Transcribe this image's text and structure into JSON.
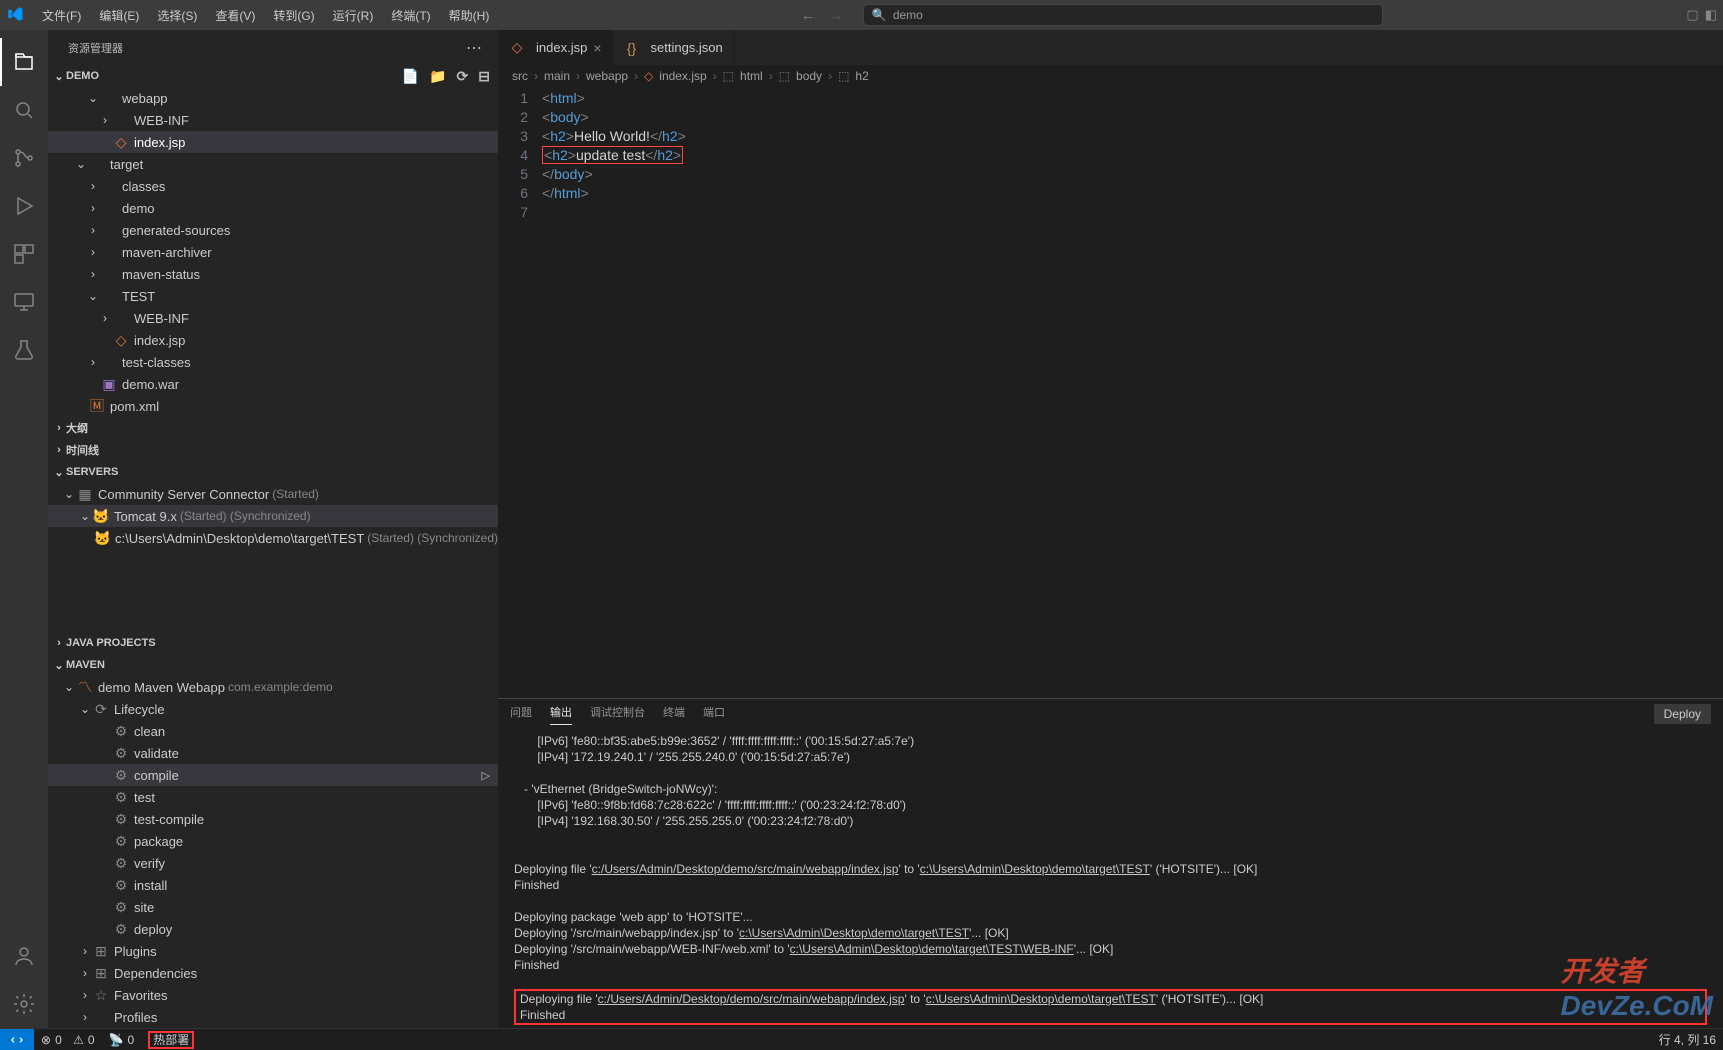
{
  "menu": [
    "文件(F)",
    "编辑(E)",
    "选择(S)",
    "查看(V)",
    "转到(G)",
    "运行(R)",
    "终端(T)",
    "帮助(H)"
  ],
  "search_placeholder": "demo",
  "sidebar": {
    "title": "资源管理器",
    "demo_section": "DEMO",
    "tree": [
      {
        "d": 1,
        "chev": "v",
        "ic": "folder",
        "label": "webapp"
      },
      {
        "d": 2,
        "chev": ">",
        "ic": "folder",
        "label": "WEB-INF"
      },
      {
        "d": 2,
        "chev": "",
        "ic": "jsp",
        "label": "index.jsp",
        "sel": true
      },
      {
        "d": 0,
        "chev": "v",
        "ic": "folder",
        "label": "target"
      },
      {
        "d": 1,
        "chev": ">",
        "ic": "folder",
        "label": "classes"
      },
      {
        "d": 1,
        "chev": ">",
        "ic": "folder",
        "label": "demo"
      },
      {
        "d": 1,
        "chev": ">",
        "ic": "folder",
        "label": "generated-sources"
      },
      {
        "d": 1,
        "chev": ">",
        "ic": "folder",
        "label": "maven-archiver"
      },
      {
        "d": 1,
        "chev": ">",
        "ic": "folder",
        "label": "maven-status"
      },
      {
        "d": 1,
        "chev": "v",
        "ic": "folder",
        "label": "TEST"
      },
      {
        "d": 2,
        "chev": ">",
        "ic": "folder",
        "label": "WEB-INF"
      },
      {
        "d": 2,
        "chev": "",
        "ic": "jsp",
        "label": "index.jsp"
      },
      {
        "d": 1,
        "chev": ">",
        "ic": "folder",
        "label": "test-classes"
      },
      {
        "d": 1,
        "chev": "",
        "ic": "zip",
        "label": "demo.war"
      },
      {
        "d": 0,
        "chev": "",
        "ic": "xml",
        "label": "pom.xml"
      }
    ],
    "outline": "大纲",
    "timeline": "时间线",
    "servers_label": "SERVERS",
    "servers": [
      {
        "d": 0,
        "chev": "v",
        "ic": "srv",
        "label": "Community Server Connector",
        "status": "(Started)"
      },
      {
        "d": 1,
        "chev": "v",
        "ic": "tom",
        "label": "Tomcat 9.x",
        "status": "(Started) (Synchronized)",
        "sel": true
      },
      {
        "d": 2,
        "chev": "",
        "ic": "tom",
        "label": "c:\\Users\\Admin\\Desktop\\demo\\target\\TEST",
        "status": "(Started) (Synchronized)"
      }
    ],
    "java_projects": "JAVA PROJECTS",
    "maven_label": "MAVEN",
    "maven_proj": {
      "name": "demo Maven Webapp",
      "sub": "com.example:demo"
    },
    "lifecycle_label": "Lifecycle",
    "lifecycle": [
      "clean",
      "validate",
      "compile",
      "test",
      "test-compile",
      "package",
      "verify",
      "install",
      "site",
      "deploy"
    ],
    "lifecycle_sel": "compile",
    "maven_extra": [
      "Plugins",
      "Dependencies",
      "Favorites",
      "Profiles"
    ]
  },
  "tabs": [
    {
      "icon": "jsp",
      "label": "index.jsp",
      "active": true,
      "close": true
    },
    {
      "icon": "json",
      "label": "settings.json",
      "active": false,
      "close": false
    }
  ],
  "breadcrumb": [
    "src",
    "main",
    "webapp",
    "index.jsp",
    "html",
    "body",
    "h2"
  ],
  "bc_icons": [
    "",
    "",
    "",
    "jsp",
    "tag",
    "tag",
    "tag"
  ],
  "code_lines": [
    [
      {
        "t": "tag",
        "v": "<"
      },
      {
        "t": "name",
        "v": "html"
      },
      {
        "t": "tag",
        "v": ">"
      }
    ],
    [
      {
        "t": "tag",
        "v": "<"
      },
      {
        "t": "name",
        "v": "body"
      },
      {
        "t": "tag",
        "v": ">"
      }
    ],
    [
      {
        "t": "tag",
        "v": "<"
      },
      {
        "t": "name",
        "v": "h2"
      },
      {
        "t": "tag",
        "v": ">"
      },
      {
        "t": "text",
        "v": "Hello World!"
      },
      {
        "t": "tag",
        "v": "</"
      },
      {
        "t": "name",
        "v": "h2"
      },
      {
        "t": "tag",
        "v": ">"
      }
    ],
    [
      {
        "hl": true,
        "seg": [
          {
            "t": "tag",
            "v": "<"
          },
          {
            "t": "name",
            "v": "h2"
          },
          {
            "t": "tag",
            "v": ">"
          },
          {
            "t": "text",
            "v": "update test"
          },
          {
            "t": "tag",
            "v": "</"
          },
          {
            "t": "name",
            "v": "h2"
          },
          {
            "t": "tag",
            "v": ">"
          }
        ]
      }
    ],
    [
      {
        "t": "tag",
        "v": "</"
      },
      {
        "t": "name",
        "v": "body"
      },
      {
        "t": "tag",
        "v": ">"
      }
    ],
    [
      {
        "t": "tag",
        "v": "</"
      },
      {
        "t": "name",
        "v": "html"
      },
      {
        "t": "tag",
        "v": ">"
      }
    ],
    []
  ],
  "panel": {
    "tabs": [
      "问题",
      "输出",
      "调试控制台",
      "终端",
      "端口"
    ],
    "active": "输出",
    "deploy_btn": "Deploy",
    "lines": [
      "       [IPv6] 'fe80::bf35:abe5:b99e:3652' / 'ffff:ffff:ffff:ffff::' ('00:15:5d:27:a5:7e')",
      "       [IPv4] '172.19.240.1' / '255.255.240.0' ('00:15:5d:27:a5:7e')",
      "",
      "   - 'vEthernet (BridgeSwitch-joNWcy)':",
      "       [IPv6] 'fe80::9f8b:fd68:7c28:622c' / 'ffff:ffff:ffff:ffff::' ('00:23:24:f2:78:d0')",
      "       [IPv4] '192.168.30.50' / '255.255.255.0' ('00:23:24:f2:78:d0')",
      "",
      "",
      "Deploying file '|u|c:/Users/Admin/Desktop/demo/src/main/webapp/index.jsp|/u|' to '|u|c:\\Users\\Admin\\Desktop\\demo\\target\\TEST|/u|' ('HOTSITE')... [OK]",
      "Finished",
      "",
      "Deploying package 'web app' to 'HOTSITE'...",
      "Deploying '/src/main/webapp/index.jsp' to '|u|c:\\Users\\Admin\\Desktop\\demo\\target\\TEST|/u|'... [OK]",
      "Deploying '/src/main/webapp/WEB-INF/web.xml' to '|u|c:\\Users\\Admin\\Desktop\\demo\\target\\TEST\\WEB-INF|/u|'... [OK]",
      "Finished",
      ""
    ],
    "boxed": [
      "Deploying file '|u|c:/Users/Admin/Desktop/demo/src/main/webapp/index.jsp|/u|' to '|u|c:\\Users\\Admin\\Desktop\\demo\\target\\TEST|/u|' ('HOTSITE')... [OK]",
      "Finished"
    ]
  },
  "status": {
    "errors": "0",
    "warnings": "0",
    "ports": "0",
    "hot": "热部署",
    "pos": "行 4, 列 16"
  },
  "watermark": "DevZe.CoM"
}
